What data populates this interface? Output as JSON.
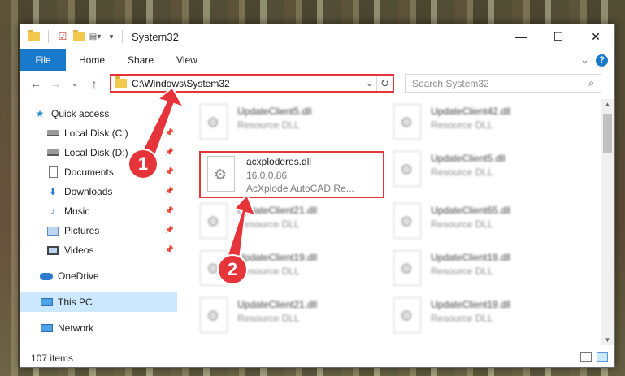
{
  "window": {
    "title": "System32",
    "minimize_glyph": "—",
    "maximize_glyph": "☐",
    "close_glyph": "✕"
  },
  "ribbon": {
    "file": "File",
    "home": "Home",
    "share": "Share",
    "view": "View",
    "expand_glyph": "⌄",
    "help_glyph": "?"
  },
  "navbar": {
    "back_glyph": "←",
    "forward_glyph": "→",
    "recent_glyph": "⌄",
    "up_glyph": "↑",
    "address": "C:\\Windows\\System32",
    "address_drop_glyph": "⌄",
    "refresh_glyph": "↻",
    "search_placeholder": "Search System32",
    "search_glyph": "⌕"
  },
  "sidebar": {
    "items": [
      {
        "label": "Quick access",
        "icon": "star-icon"
      },
      {
        "label": "Local Disk (C:)",
        "icon": "drive-icon",
        "pinned": true
      },
      {
        "label": "Local Disk (D:)",
        "icon": "drive-icon",
        "pinned": true
      },
      {
        "label": "Documents",
        "icon": "document-icon",
        "pinned": true
      },
      {
        "label": "Downloads",
        "icon": "download-icon",
        "pinned": true
      },
      {
        "label": "Music",
        "icon": "music-icon",
        "pinned": true
      },
      {
        "label": "Pictures",
        "icon": "pictures-icon",
        "pinned": true
      },
      {
        "label": "Videos",
        "icon": "videos-icon",
        "pinned": true
      },
      {
        "label": "OneDrive",
        "icon": "cloud-icon"
      },
      {
        "label": "This PC",
        "icon": "computer-icon",
        "selected": true
      },
      {
        "label": "Network",
        "icon": "network-icon"
      }
    ],
    "pin_glyph": "📌"
  },
  "files": {
    "left": [
      {
        "name": "UpdateClient5.dll",
        "type": "Resource DLL"
      },
      {
        "name": "acxploderes.dll",
        "version": "16.0.0.86",
        "description": "AcXplode AutoCAD Re..."
      },
      {
        "name": "UpdateClient21.dll",
        "type": "Resource DLL"
      },
      {
        "name": "UpdateClient19.dll",
        "type": "Resource DLL"
      },
      {
        "name": "UpdateClient21.dll",
        "type": "Resource DLL"
      }
    ],
    "right": [
      {
        "name": "UpdateClient42.dll",
        "type": "Resource DLL"
      },
      {
        "name": "UpdateClient5.dll",
        "type": "Resource DLL"
      },
      {
        "name": "UpdateClient65.dll",
        "type": "Resource DLL"
      },
      {
        "name": "UpdateClient19.dll",
        "type": "Resource DLL"
      },
      {
        "name": "UpdateClient19.dll",
        "type": "Resource DLL"
      }
    ]
  },
  "status": {
    "item_count": "107 items"
  },
  "annotations": {
    "step1": "1",
    "step2": "2",
    "accent_color": "#e5353a"
  }
}
